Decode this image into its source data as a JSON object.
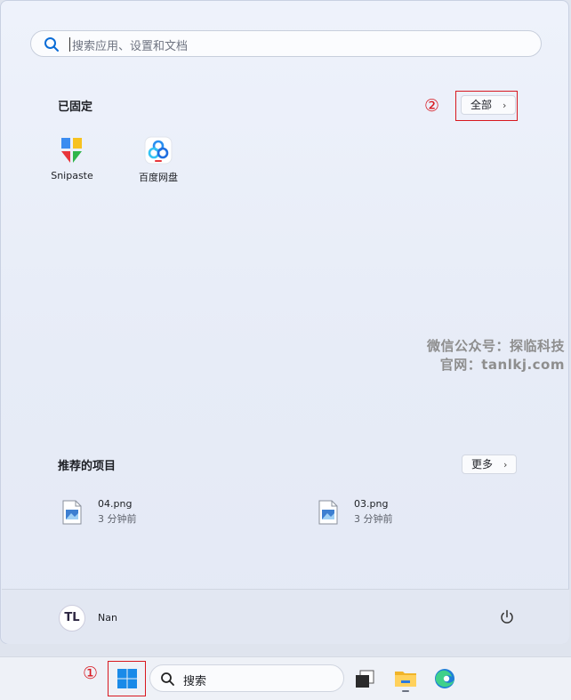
{
  "search": {
    "placeholder": "搜索应用、设置和文档"
  },
  "pinned": {
    "title": "已固定",
    "all_button": "全部",
    "annotation": "②",
    "apps": [
      {
        "label": "Snipaste",
        "icon": "snipaste-icon"
      },
      {
        "label": "百度网盘",
        "icon": "baidu-netdisk-icon"
      }
    ]
  },
  "watermark": {
    "line1": "微信公众号：探临科技",
    "line2": "官网：tanlkj.com"
  },
  "recommended": {
    "title": "推荐的项目",
    "more_button": "更多",
    "items": [
      {
        "name": "04.png",
        "time": "3 分钟前",
        "icon": "image-file-icon"
      },
      {
        "name": "03.png",
        "time": "3 分钟前",
        "icon": "image-file-icon"
      }
    ]
  },
  "user": {
    "name": "Nan",
    "avatar_text": "TL"
  },
  "taskbar": {
    "annotation": "①",
    "search_label": "搜索",
    "items": [
      "start-button",
      "search",
      "task-view",
      "file-explorer",
      "edge"
    ]
  },
  "colors": {
    "annotation_red": "#d8181f",
    "accent_blue": "#0a6cd6"
  }
}
